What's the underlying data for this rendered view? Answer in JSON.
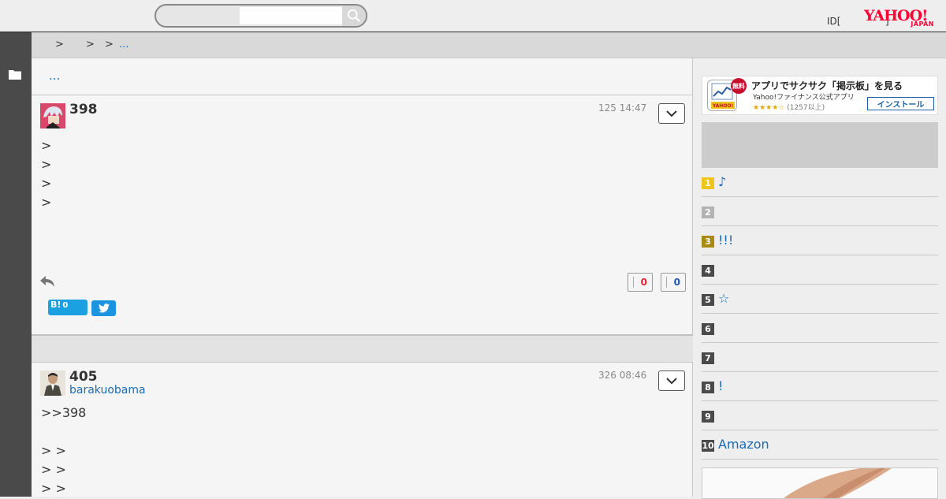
{
  "header": {
    "search_placeholder": "",
    "id_label": "ID[",
    "right_mark": "]",
    "logo_main": "YAHOO!",
    "logo_sub": "JAPAN"
  },
  "breadcrumb": {
    "sep1": ">",
    "sep2": ">",
    "sep3": ">",
    "ellipsis": "..."
  },
  "thread": {
    "more_link": "..."
  },
  "posts": [
    {
      "number": "398",
      "username": "",
      "date": "125 14:47",
      "lines": [
        ">",
        ">",
        ">",
        ">"
      ],
      "likes": "0",
      "dislikes": "0",
      "hatena_label": "B!",
      "hatena_count": "0"
    },
    {
      "number": "405",
      "username": "barakuobama",
      "date": "326 08:46",
      "lines": [
        ">>398",
        "",
        "> >",
        "> >",
        "> >"
      ]
    }
  ],
  "sidebar": {
    "app_banner": {
      "free_badge": "無料",
      "title": "アプリでサクサク「掲示板」を見る",
      "subtitle": "Yahoo!ファイナンス公式アプリ",
      "stars": "★★★★☆",
      "review_count": "(1257以上)",
      "install_label": "インストール"
    },
    "ranking": [
      {
        "rank": "1",
        "text": "♪",
        "color": "#f0c419"
      },
      {
        "rank": "2",
        "text": "",
        "color": "#b3b3b3"
      },
      {
        "rank": "3",
        "text": "!!!",
        "color": "#a88a12"
      },
      {
        "rank": "4",
        "text": "",
        "color": "#4a4a4a"
      },
      {
        "rank": "5",
        "text": "☆",
        "color": "#4a4a4a"
      },
      {
        "rank": "6",
        "text": "",
        "color": "#4a4a4a"
      },
      {
        "rank": "7",
        "text": "",
        "color": "#4a4a4a"
      },
      {
        "rank": "8",
        "text": "!",
        "color": "#4a4a4a"
      },
      {
        "rank": "9",
        "text": "",
        "color": "#4a4a4a"
      },
      {
        "rank": "10",
        "text": "Amazon",
        "color": "#4a4a4a"
      }
    ]
  },
  "colors": {
    "link": "#1a6bb5",
    "brand_red": "#ff0033",
    "sidebar_dark": "#4a4a4a"
  }
}
